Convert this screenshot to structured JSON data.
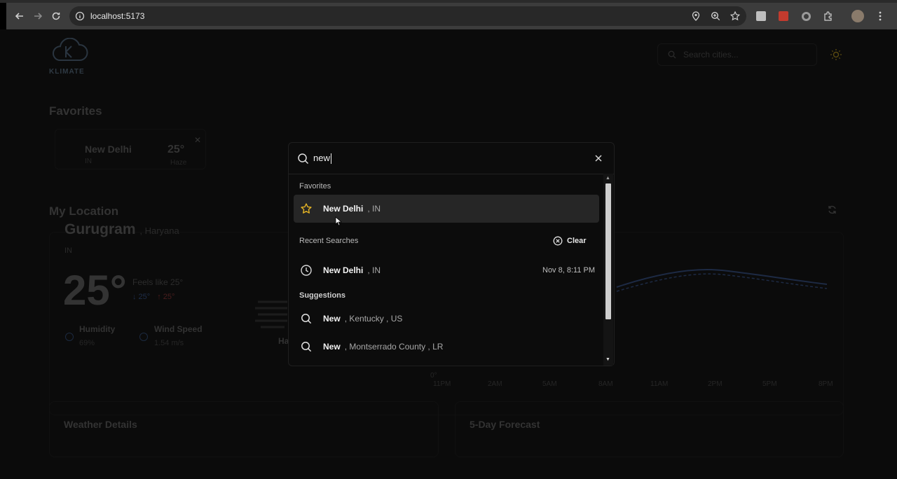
{
  "browser": {
    "url": "localhost:5173"
  },
  "app": {
    "logo_text": "KLIMATE",
    "search_placeholder": "Search cities...",
    "favorites_heading": "Favorites",
    "favorite_card": {
      "city": "New Delhi",
      "country": "IN",
      "temp": "25°",
      "condition": "Haze"
    },
    "my_location_heading": "My Location",
    "location": {
      "city": "Gurugram",
      "state": ", Haryana",
      "country": "IN",
      "temp": "25°",
      "feels_like": "Feels like 25°",
      "min": "↓ 25°",
      "max": "↑ 25°",
      "humidity_label": "Humidity",
      "humidity_value": "69%",
      "wind_label": "Wind Speed",
      "wind_value": "1.54 m/s",
      "condition": "Haze"
    },
    "chart_ticks": [
      "0°",
      "11PM",
      "2AM",
      "5AM",
      "8AM",
      "11AM",
      "2PM",
      "5PM",
      "8PM"
    ],
    "weather_details_heading": "Weather Details",
    "forecast_heading": "5-Day Forecast"
  },
  "dialog": {
    "query": "new",
    "favorites_heading": "Favorites",
    "favorites": [
      {
        "name": "New Delhi",
        "meta": ", IN"
      }
    ],
    "recent_heading": "Recent Searches",
    "clear_label": "Clear",
    "recent": [
      {
        "name": "New Delhi",
        "meta": ", IN",
        "time": "Nov 8, 8:11 PM"
      }
    ],
    "suggestions_heading": "Suggestions",
    "suggestions": [
      {
        "name": "New",
        "meta": ", Kentucky , US"
      },
      {
        "name": "New",
        "meta": ", Montserrado County , LR"
      }
    ]
  },
  "colors": {
    "star": "#e3b325",
    "backdrop": "#0b0b0b",
    "dialog_bg": "#0c0c0c"
  }
}
